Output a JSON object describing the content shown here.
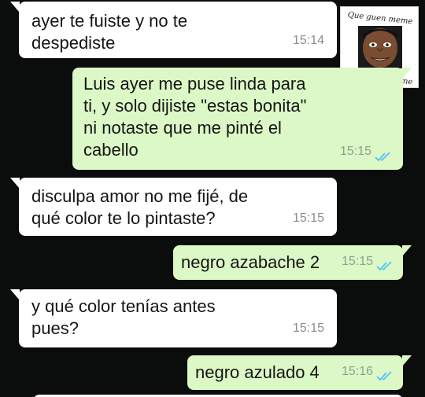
{
  "messages": [
    {
      "direction": "incoming",
      "text": "ayer te fuiste y no te\ndespediste",
      "time": "15:14"
    },
    {
      "direction": "outgoing",
      "text": "Luis ayer me puse linda para\nti, y solo dijiste \"estas bonita\"\nni notaste que me pinté el\ncabello",
      "time": "15:15",
      "status": "read"
    },
    {
      "direction": "incoming",
      "text": "disculpa amor no me fijé, de\nqué color te lo pintaste?",
      "time": "15:15"
    },
    {
      "direction": "outgoing",
      "text": "negro azabache 2",
      "time": "15:15",
      "status": "read"
    },
    {
      "direction": "incoming",
      "text": "y qué color tenías antes\npues?",
      "time": "15:15"
    },
    {
      "direction": "outgoing",
      "text": "negro azulado 4",
      "time": "15:16",
      "status": "read"
    }
  ],
  "sticker": {
    "caption_top": "Que guen meme",
    "caption_bottom": "Qué guen meme"
  },
  "colors": {
    "background": "#0b0d0c",
    "incoming_bubble": "#ffffff",
    "outgoing_bubble": "#dcf8c6",
    "read_ticks": "#4fc3f7"
  },
  "icons": {
    "read_receipt": "double-check-icon"
  }
}
